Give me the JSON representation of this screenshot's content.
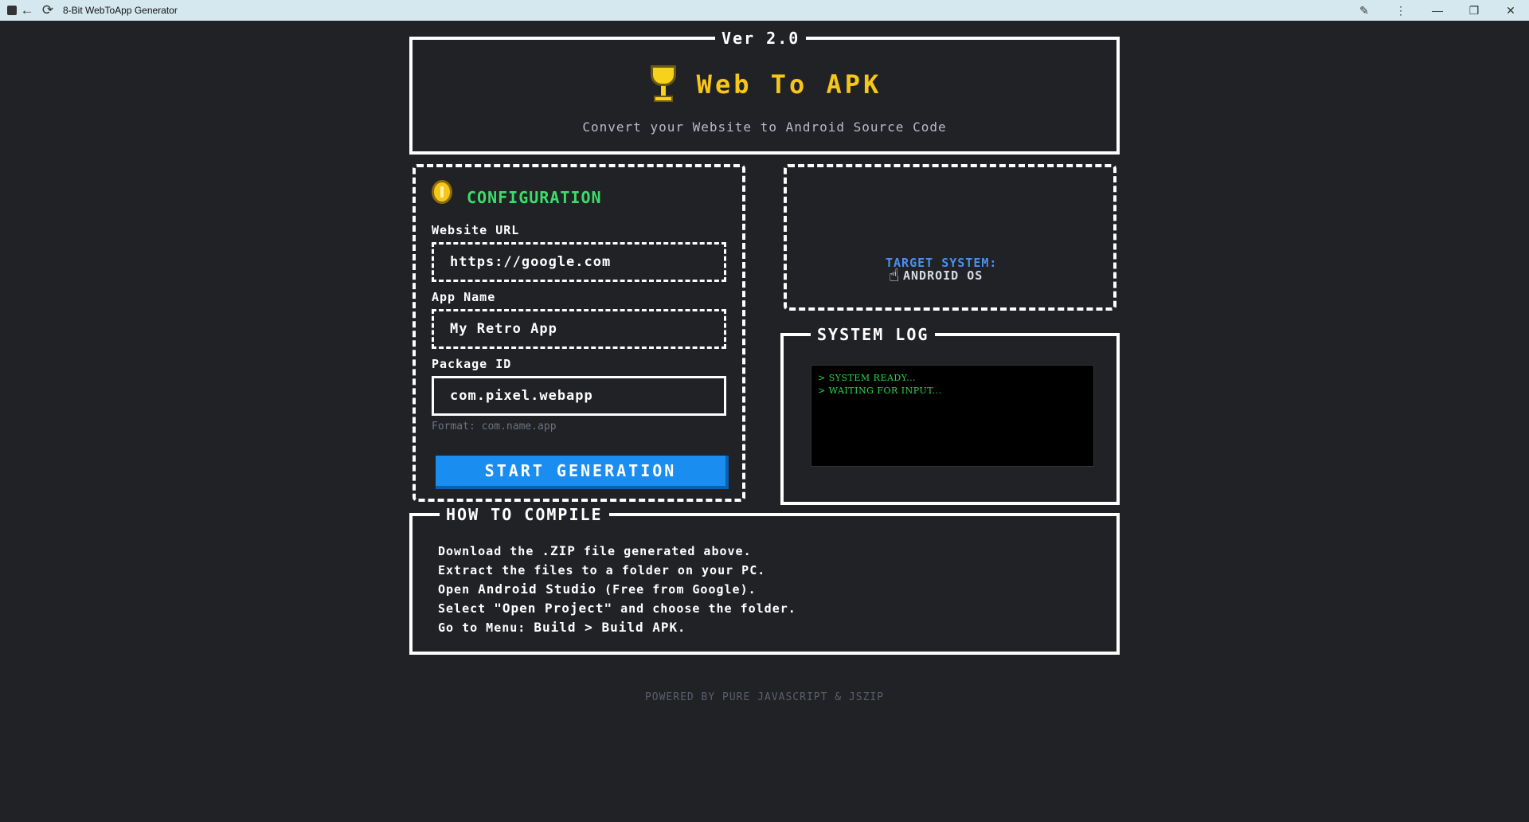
{
  "window": {
    "title": "8-Bit WebToApp Generator"
  },
  "header": {
    "version": "Ver 2.0",
    "title": "Web To APK",
    "subtitle": "Convert your Website to Android Source Code"
  },
  "config": {
    "title": "CONFIGURATION",
    "url_label": "Website URL",
    "url_value": "https://google.com",
    "name_label": "App Name",
    "name_value": "My Retro App",
    "package_label": "Package ID",
    "package_value": "com.pixel.webapp",
    "package_hint": "Format: com.name.app",
    "start_label": "START GENERATION"
  },
  "target": {
    "line1": "TARGET SYSTEM:",
    "line2": "ANDROID OS"
  },
  "log": {
    "title": "SYSTEM LOG",
    "lines": [
      "> SYSTEM READY...",
      "> WAITING FOR INPUT..."
    ]
  },
  "howto": {
    "title": "HOW TO COMPILE",
    "steps": [
      {
        "a": "Download the ",
        "b": ".ZIP",
        "c": " file generated above.",
        "d": "",
        "e": ""
      },
      {
        "a": "Extract the files to a folder on your PC.",
        "b": "",
        "c": "",
        "d": "",
        "e": ""
      },
      {
        "a": "Open ",
        "b": "Android Studio",
        "c": " (Free from Google).",
        "d": "",
        "e": ""
      },
      {
        "a": "Select ",
        "b": "\"Open Project\"",
        "c": " and choose the folder.",
        "d": "",
        "e": ""
      },
      {
        "a": "Go to Menu: ",
        "b": "Build",
        "c": " > ",
        "d": "Build APK",
        "e": "."
      }
    ]
  },
  "footer": {
    "text": "POWERED BY PURE JAVASCRIPT & JSZIP"
  }
}
